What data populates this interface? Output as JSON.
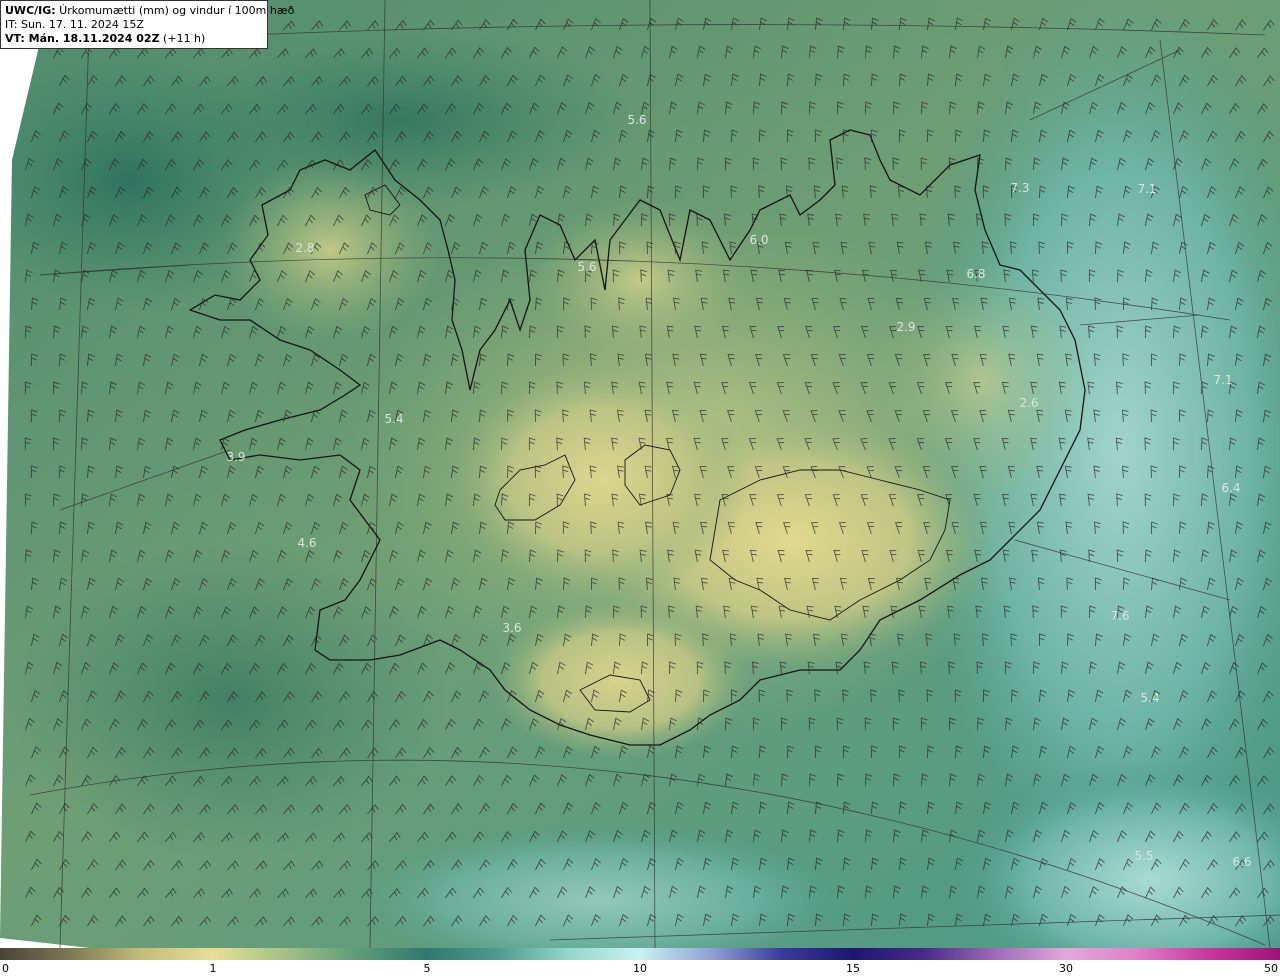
{
  "title": {
    "product_bold": "UWC/IG:",
    "product_text": " Úrkomumætti (mm) og vindur í 100m hæð",
    "issue_time": "IT: Sun. 17. 11. 2024 15Z",
    "valid_prefix": "VT: Mán. 18.11.2024 02Z",
    "valid_suffix": " (+11 h)"
  },
  "field_labels": [
    "5.6",
    "7.3",
    "7.1",
    "6.0",
    "5.6",
    "2.8",
    "6.8",
    "2.9",
    "7.1",
    "2.6",
    "5.4",
    "3.9",
    "6.4",
    "4.6",
    "7.6",
    "3.6",
    "5.4",
    "5.5",
    "6.6"
  ],
  "colorbar": {
    "ticks": [
      "0",
      "1",
      "5",
      "10",
      "15",
      "30",
      "50"
    ],
    "colors": [
      "#4a4436",
      "#7e7a52",
      "#c4bd7a",
      "#e8df94",
      "#a5c184",
      "#5d9d79",
      "#2f7a6e",
      "#4f9a8e",
      "#94d6cc",
      "#c8f2ef",
      "#8fa0d6",
      "#3b3a9c",
      "#1d1672",
      "#4a2a8a",
      "#a06ab8",
      "#e2a8dc",
      "#e07ec8",
      "#c8379e",
      "#9c1478"
    ]
  },
  "palette": {
    "background_sea": "#3c8a74",
    "land_light": "#d8d58c",
    "coast": "#151515",
    "barbs": "#2b2b2b",
    "grid": "#3a3a3a"
  }
}
